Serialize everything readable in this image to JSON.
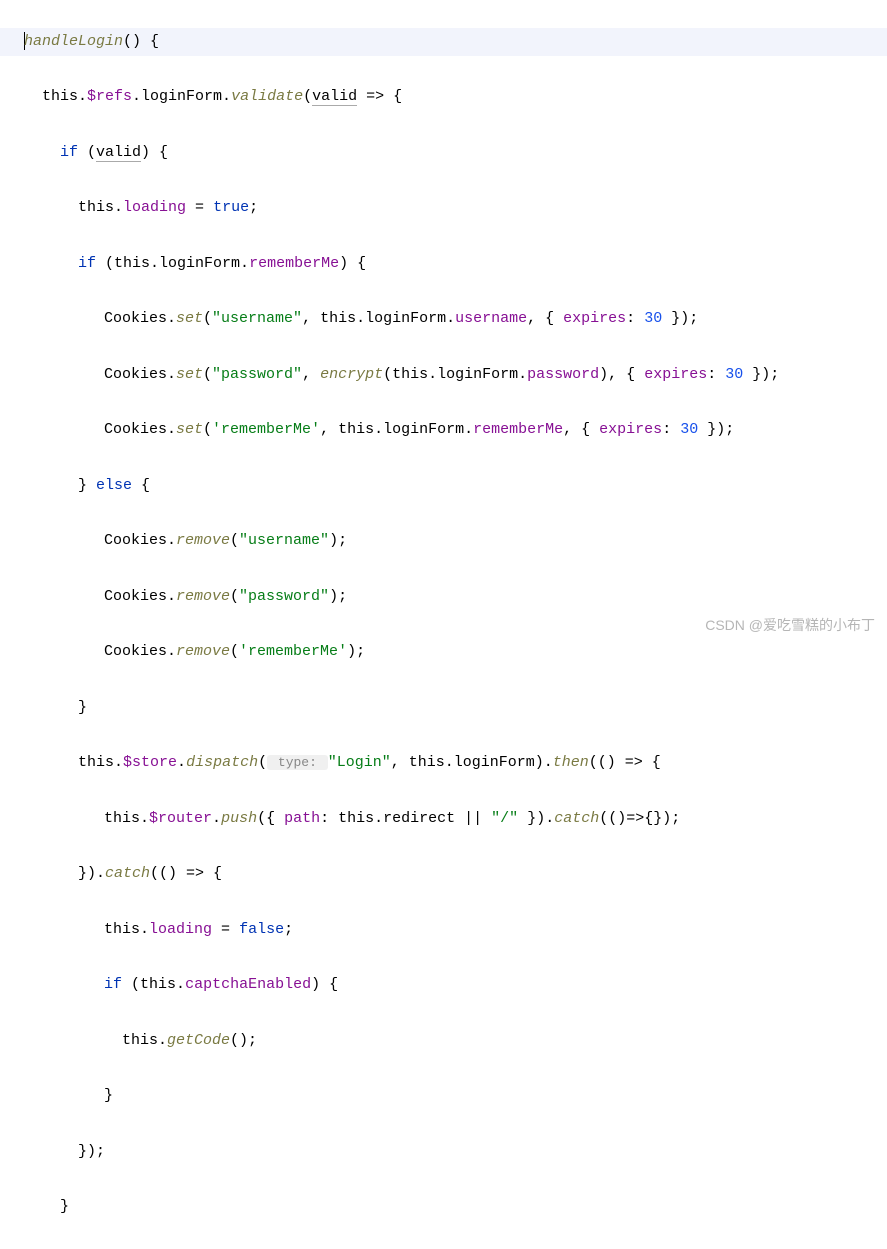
{
  "code": {
    "l1a": "handleLogin",
    "l1b": "() {",
    "l2a": "this",
    "l2b": ".",
    "l2c": "$refs",
    "l2d": ".loginForm.",
    "l2e": "validate",
    "l2f": "(",
    "l2g": "valid",
    "l2h": " => {",
    "l3a": "if",
    "l3b": " (",
    "l3c": "valid",
    "l3d": ") {",
    "l4a": "this",
    "l4b": ".",
    "l4c": "loading",
    "l4d": " = ",
    "l4e": "true",
    "l4f": ";",
    "l5a": "if",
    "l5b": " (",
    "l5c": "this",
    "l5d": ".loginForm.",
    "l5e": "rememberMe",
    "l5f": ") {",
    "l6a": "Cookies.",
    "l6b": "set",
    "l6c": "(",
    "l6d": "\"username\"",
    "l6e": ", ",
    "l6f": "this",
    "l6g": ".loginForm.",
    "l6h": "username",
    "l6i": ", { ",
    "l6j": "expires",
    "l6k": ": ",
    "l6l": "30",
    "l6m": " });",
    "l7a": "Cookies.",
    "l7b": "set",
    "l7c": "(",
    "l7d": "\"password\"",
    "l7e": ", ",
    "l7f": "encrypt",
    "l7g": "(",
    "l7h": "this",
    "l7i": ".loginForm.",
    "l7j": "password",
    "l7k": "), { ",
    "l7l": "expires",
    "l7m": ": ",
    "l7n": "30",
    "l7o": " });",
    "l8a": "Cookies.",
    "l8b": "set",
    "l8c": "(",
    "l8d": "'rememberMe'",
    "l8e": ", ",
    "l8f": "this",
    "l8g": ".loginForm.",
    "l8h": "rememberMe",
    "l8i": ", { ",
    "l8j": "expires",
    "l8k": ": ",
    "l8l": "30",
    "l8m": " });",
    "l9a": "} ",
    "l9b": "else",
    "l9c": " {",
    "l10a": "Cookies.",
    "l10b": "remove",
    "l10c": "(",
    "l10d": "\"username\"",
    "l10e": ");",
    "l11a": "Cookies.",
    "l11b": "remove",
    "l11c": "(",
    "l11d": "\"password\"",
    "l11e": ");",
    "l12a": "Cookies.",
    "l12b": "remove",
    "l12c": "(",
    "l12d": "'rememberMe'",
    "l12e": ");",
    "l13": "}",
    "l14a": "this",
    "l14b": ".",
    "l14c": "$store",
    "l14d": ".",
    "l14e": "dispatch",
    "l14f": "(",
    "l14g": " type: ",
    "l14h": "\"Login\"",
    "l14i": ", ",
    "l14j": "this",
    "l14k": ".loginForm).",
    "l14l": "then",
    "l14m": "(() => {",
    "l15a": "this",
    "l15b": ".",
    "l15c": "$router",
    "l15d": ".",
    "l15e": "push",
    "l15f": "({ ",
    "l15g": "path",
    "l15h": ": ",
    "l15i": "this",
    "l15j": ".redirect || ",
    "l15k": "\"/\"",
    "l15l": " }).",
    "l15m": "catch",
    "l15n": "(()=>{});",
    "l16a": "}).",
    "l16b": "catch",
    "l16c": "(() => {",
    "l17a": "this",
    "l17b": ".",
    "l17c": "loading",
    "l17d": " = ",
    "l17e": "false",
    "l17f": ";",
    "l18a": "if",
    "l18b": " (",
    "l18c": "this",
    "l18d": ".",
    "l18e": "captchaEnabled",
    "l18f": ") {",
    "l19a": "this",
    "l19b": ".",
    "l19c": "getCode",
    "l19d": "();",
    "l20": "}",
    "l21": "});",
    "l22": "}"
  },
  "watermark": "CSDN @爱吃雪糕的小布丁"
}
